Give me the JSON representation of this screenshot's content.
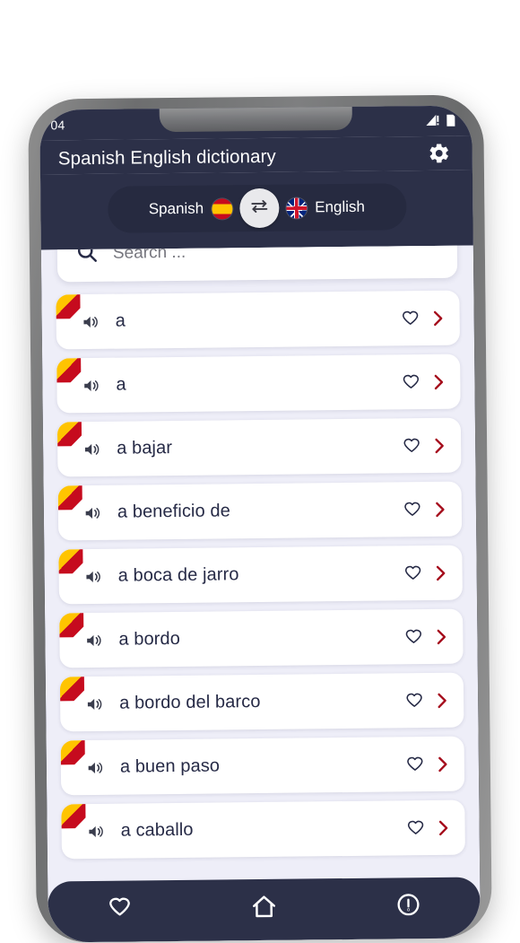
{
  "status_bar": {
    "time": "04",
    "signal_icon": "signal-warning-icon",
    "battery_icon": "battery-icon"
  },
  "app_bar": {
    "title": "Spanish English dictionary",
    "settings_icon": "gear-icon"
  },
  "language_switcher": {
    "source_language": "Spanish",
    "source_flag": "spain-flag-icon",
    "target_language": "English",
    "target_flag": "uk-flag-icon",
    "swap_icon": "swap-arrows-icon"
  },
  "search": {
    "placeholder": "Search ...",
    "value": "",
    "icon": "search-icon"
  },
  "list": {
    "row_icons": {
      "flag_corner": "spain-flag-corner-icon",
      "speaker": "speaker-icon",
      "favorite": "heart-outline-icon",
      "chevron": "chevron-right-icon"
    },
    "items": [
      {
        "word": "a"
      },
      {
        "word": "a"
      },
      {
        "word": "a bajar"
      },
      {
        "word": "a beneficio de"
      },
      {
        "word": "a boca de jarro"
      },
      {
        "word": "a bordo"
      },
      {
        "word": "a bordo del barco"
      },
      {
        "word": "a buen paso"
      },
      {
        "word": "a caballo"
      }
    ]
  },
  "bottom_nav": {
    "items": [
      {
        "icon": "heart-icon",
        "name": "favorites"
      },
      {
        "icon": "home-icon",
        "name": "home"
      },
      {
        "icon": "info-icon",
        "name": "info"
      }
    ]
  },
  "colors": {
    "app_bar_bg": "#2c3048",
    "screen_bg": "#eeeef8",
    "card_bg": "#ffffff",
    "text_primary": "#262a46",
    "accent_red": "#a50d1c",
    "flag_red": "#c60b1e",
    "flag_yellow": "#ffc400"
  }
}
